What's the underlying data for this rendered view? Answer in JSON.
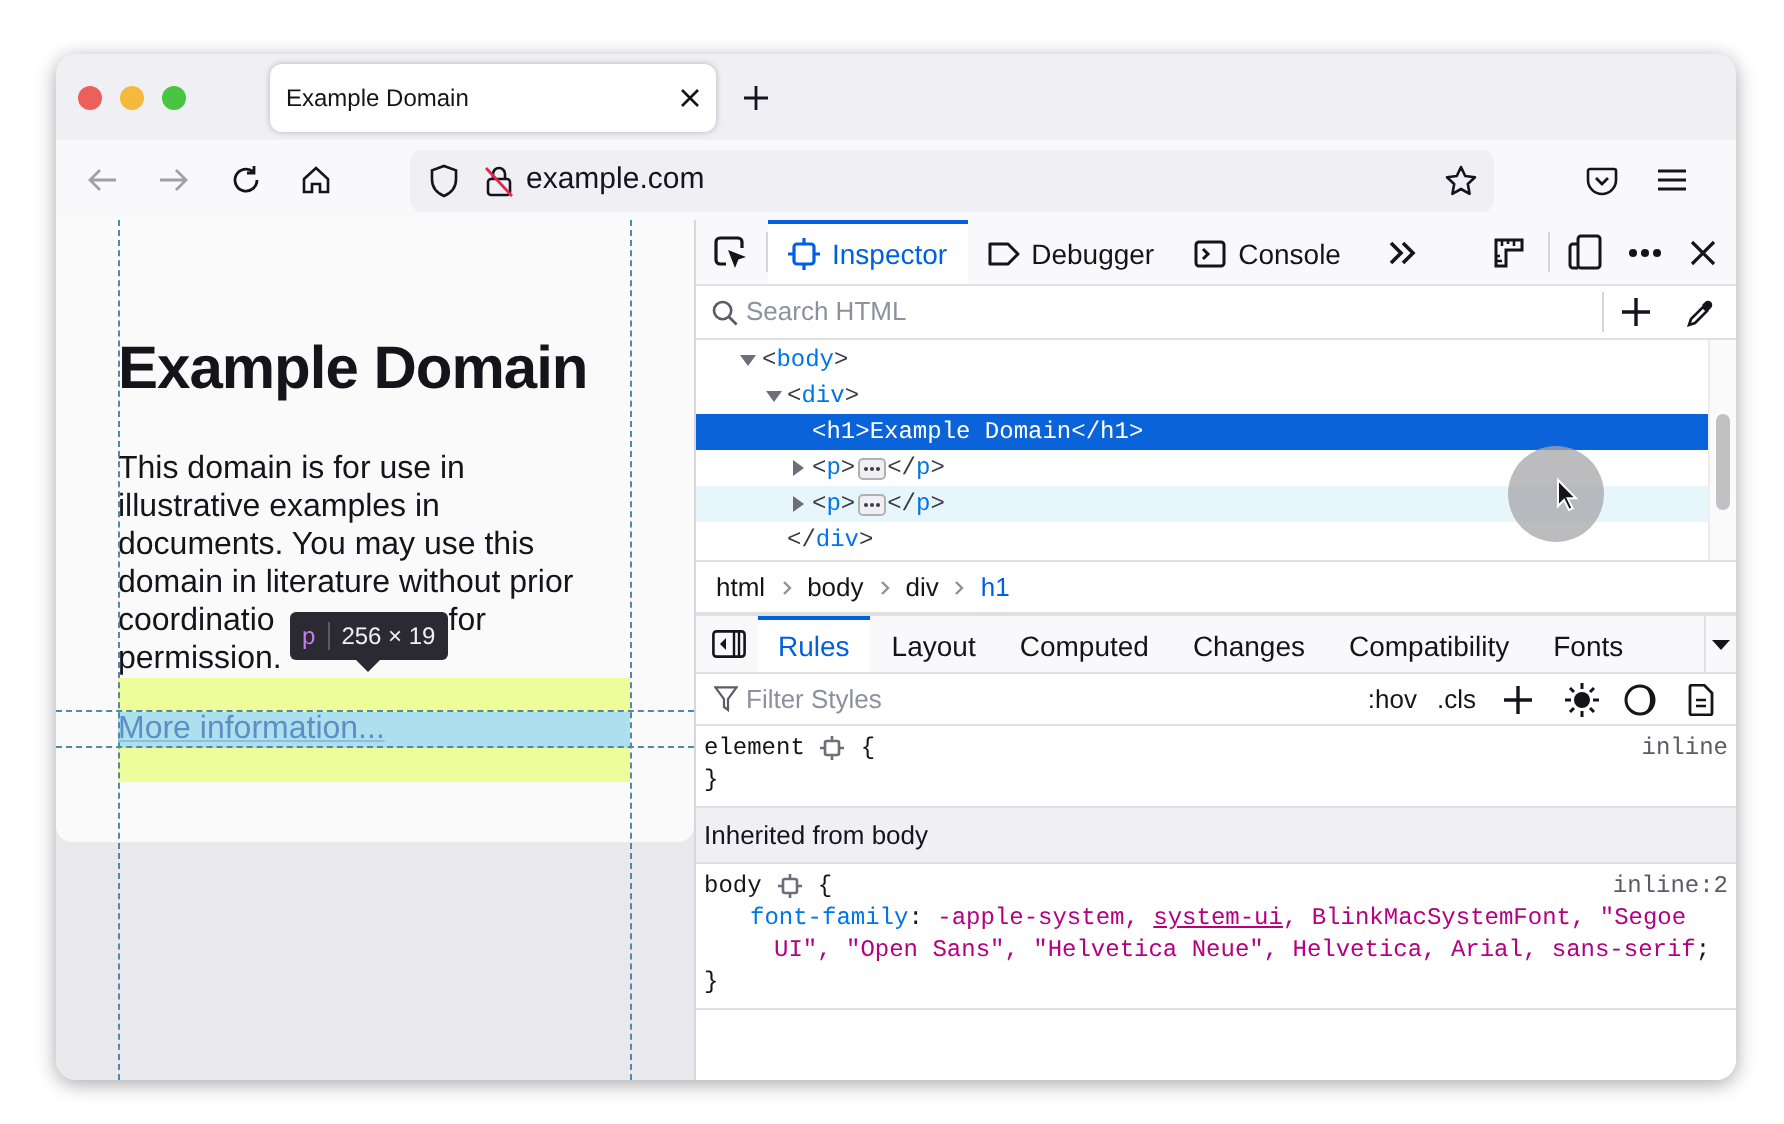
{
  "browser": {
    "tabs": [
      {
        "title": "Example Domain",
        "selected": true
      }
    ],
    "address": "example.com"
  },
  "page": {
    "heading": "Example Domain",
    "paragraph": {
      "lines": [
        "This domain is for use in",
        "illustrative examples in",
        "documents. You may use this",
        "domain in literature without prior"
      ],
      "covered_line": {
        "before": "coordinatio",
        "after": "for"
      },
      "last_line": "permission."
    },
    "link": "More information...",
    "tooltip": {
      "tag": "p",
      "size": "256 × 19"
    }
  },
  "devtools": {
    "tools": [
      {
        "label": "Inspector",
        "kind": "inspector",
        "selected": true
      },
      {
        "label": "Debugger",
        "kind": "debugger",
        "selected": false
      },
      {
        "label": "Console",
        "kind": "console",
        "selected": false
      }
    ],
    "search": {
      "placeholder": "Search HTML"
    },
    "tree": [
      {
        "open": "<body>",
        "expanded": true,
        "selected": false,
        "hovered": false,
        "children": [
          {
            "open": "<div>",
            "expanded": true,
            "selected": false,
            "hovered": false,
            "close": "</div>",
            "children": [
              {
                "open": "<h1>Example Domain</h1>",
                "selected": true
              },
              {
                "open": "<p>",
                "close": "</p>",
                "expanded": false,
                "selected": false,
                "hovered": false
              },
              {
                "open": "<p>",
                "close": "</p>",
                "expanded": false,
                "selected": false,
                "hovered": true
              }
            ]
          }
        ]
      }
    ],
    "breadcrumbs": [
      {
        "label": "html",
        "selected": false
      },
      {
        "label": "body",
        "selected": false
      },
      {
        "label": "div",
        "selected": false
      },
      {
        "label": "h1",
        "selected": true
      }
    ],
    "sidebar_tabs": [
      {
        "label": "Rules",
        "selected": true
      },
      {
        "label": "Layout",
        "selected": false
      },
      {
        "label": "Computed",
        "selected": false
      },
      {
        "label": "Changes",
        "selected": false
      },
      {
        "label": "Compatibility",
        "selected": false
      },
      {
        "label": "Fonts",
        "selected": false
      }
    ],
    "filter": {
      "placeholder": "Filter Styles"
    },
    "toggles": [
      ":hov",
      ".cls"
    ],
    "rules": [
      {
        "kind": "rule",
        "selector": "element",
        "open": "{",
        "close": "}",
        "source": "inline"
      },
      {
        "kind": "header",
        "text": "Inherited from body"
      },
      {
        "kind": "rule",
        "selector": "body",
        "open": "{",
        "close": "}",
        "source": "inline:2",
        "declarations": [
          {
            "property": "font-family",
            "separator": ":",
            "terminator": ";",
            "value": [
              {
                "text": " -apple-system, "
              },
              {
                "text": "system-ui",
                "kind": "link"
              },
              {
                "text": ", BlinkMacSystemFont, \"Segoe UI\", \"Open Sans\", \"Helvetica Neue\", Helvetica, Arial, sans-serif"
              }
            ]
          }
        ]
      }
    ]
  }
}
